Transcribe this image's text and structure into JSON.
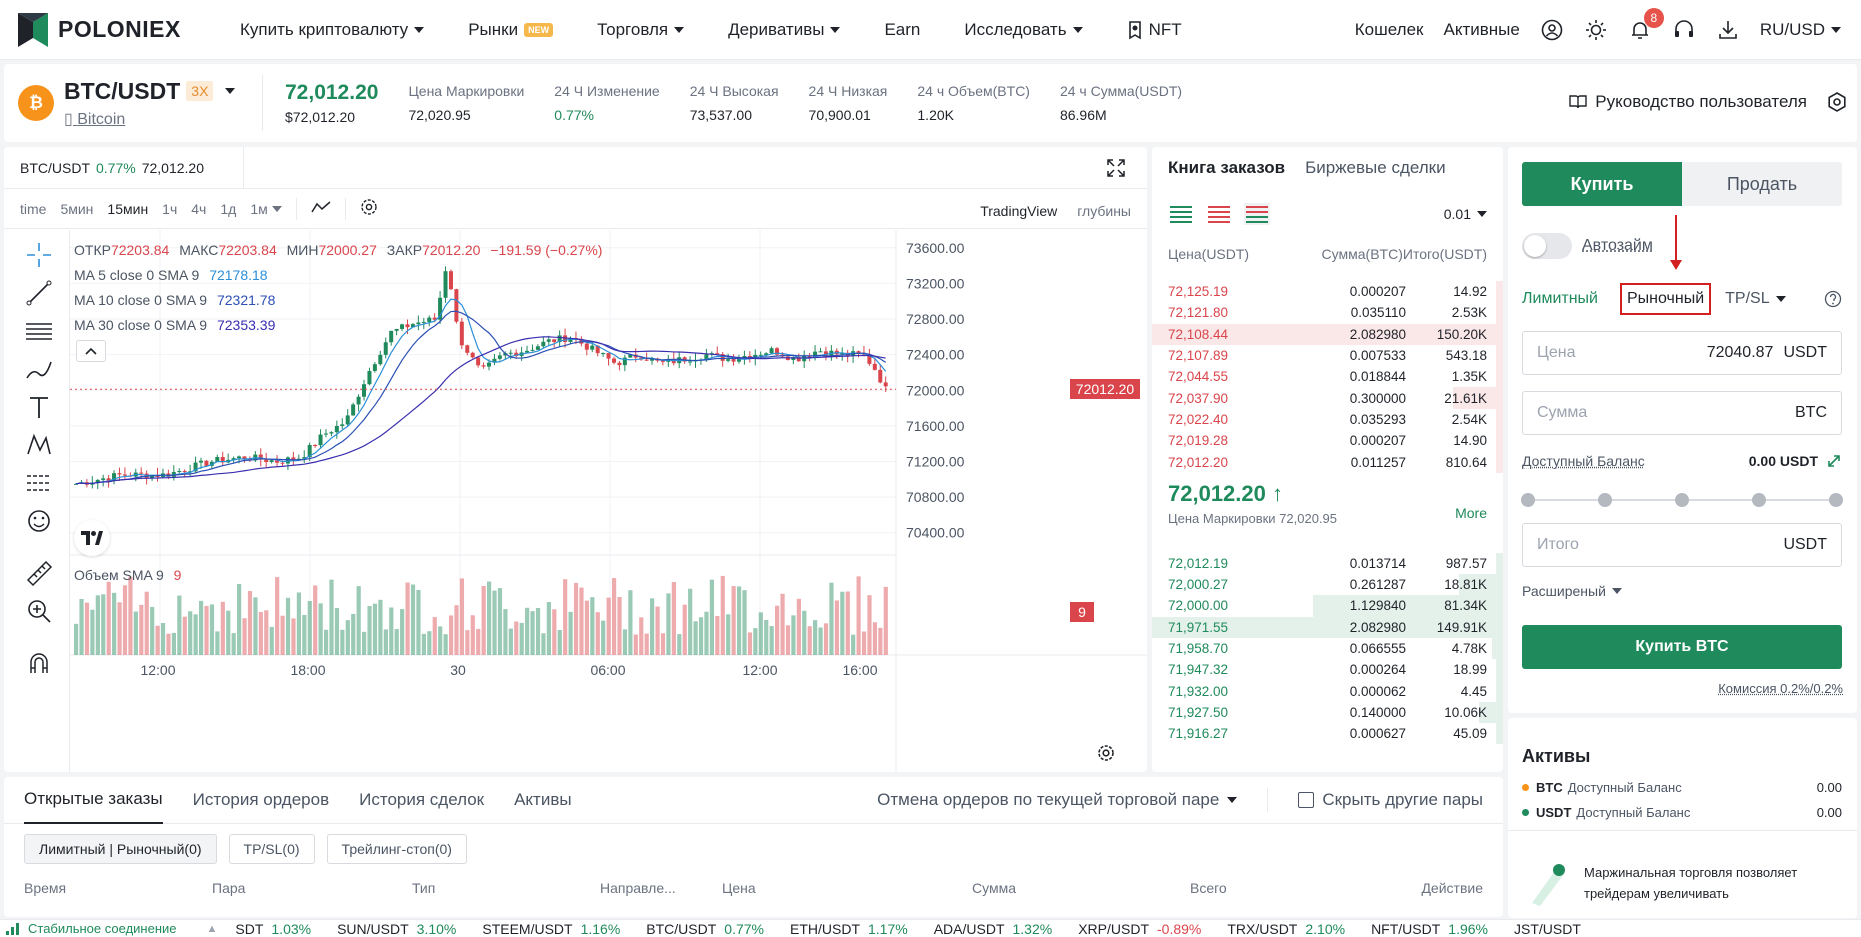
{
  "nav": {
    "brand": "POLONIEX",
    "items": [
      {
        "label": "Купить криптовалюту",
        "caret": true
      },
      {
        "label": "Рынки",
        "badge": "NEW"
      },
      {
        "label": "Торговля",
        "caret": true
      },
      {
        "label": "Деривативы",
        "caret": true
      },
      {
        "label": "Earn"
      },
      {
        "label": "Исследовать",
        "caret": true
      },
      {
        "label": "NFT"
      }
    ],
    "wallet": "Кошелек",
    "assets": "Активные",
    "notifications": "8",
    "locale": "RU/USD"
  },
  "ticker": {
    "pair": "BTC/USDT",
    "leverage": "3X",
    "coin_name": "Bitcoin",
    "last_price": "72,012.20",
    "last_price_usd": "$72,012.20",
    "mark_label": "Цена Маркировки",
    "mark_value": "72,020.95",
    "change_label": "24 Ч Изменение",
    "change_value": "0.77%",
    "high_label": "24 Ч Высокая",
    "high_value": "73,537.00",
    "low_label": "24 Ч Низкая",
    "low_value": "70,900.01",
    "volbtc_label": "24 ч Объем(BTC)",
    "volbtc_value": "1.20K",
    "volusdt_label": "24 ч Сумма(USDT)",
    "volusdt_value": "86.96M",
    "guide": "Руководство пользователя"
  },
  "chart": {
    "tab_pair": "BTC/USDT",
    "tab_change": "0.77%",
    "tab_price": "72,012.20",
    "intervals": [
      "time",
      "5мин",
      "15мин",
      "1ч",
      "4ч",
      "1д",
      "1м"
    ],
    "selected_interval": "15мин",
    "view_tv": "TradingView",
    "view_depth": "глубины",
    "ohlc": {
      "o_label": "ОТКР",
      "o": "72203.84",
      "h_label": "МАКС",
      "h": "72203.84",
      "l_label": "МИН",
      "l": "72000.27",
      "c_label": "ЗАКР",
      "c": "72012.20",
      "chg": "−191.59 (−0.27%)"
    },
    "ma": [
      {
        "label": "MA 5 close 0 SMA 9",
        "value": "72178.18",
        "color": "#2a8fd8"
      },
      {
        "label": "MA 10 close 0 SMA 9",
        "value": "72321.78",
        "color": "#2b4fb5"
      },
      {
        "label": "MA 30 close 0 SMA 9",
        "value": "72353.39",
        "color": "#3a2fb0"
      }
    ],
    "price_ticks": [
      "73600.00",
      "73200.00",
      "72800.00",
      "72400.00",
      "72000.00",
      "71600.00",
      "71200.00",
      "70800.00",
      "70400.00"
    ],
    "price_tag": "72012.20",
    "volume_label": "Объем SMA 9",
    "volume_value": "9",
    "volume_tag": "9",
    "time_ticks": [
      "12:00",
      "18:00",
      "30",
      "06:00",
      "12:00",
      "16:00"
    ]
  },
  "book": {
    "tab_book": "Книга заказов",
    "tab_trades": "Биржевые сделки",
    "step": "0.01",
    "headers": [
      "Цена(USDT)",
      "Сумма(BTC)",
      "Итого(USDT)"
    ],
    "asks": [
      [
        "72,125.19",
        "0.000207",
        "14.92"
      ],
      [
        "72,121.80",
        "0.035110",
        "2.53K"
      ],
      [
        "72,108.44",
        "2.082980",
        "150.20K"
      ],
      [
        "72,107.89",
        "0.007533",
        "543.18"
      ],
      [
        "72,044.55",
        "0.018844",
        "1.35K"
      ],
      [
        "72,037.90",
        "0.300000",
        "21.61K"
      ],
      [
        "72,022.40",
        "0.035293",
        "2.54K"
      ],
      [
        "72,019.28",
        "0.000207",
        "14.90"
      ],
      [
        "72,012.20",
        "0.011257",
        "810.64"
      ]
    ],
    "mid_price": "72,012.20 ↑",
    "mid_mark": "Цена Маркировки 72,020.95",
    "more": "More",
    "bids": [
      [
        "72,012.19",
        "0.013714",
        "987.57"
      ],
      [
        "72,000.27",
        "0.261287",
        "18.81K"
      ],
      [
        "72,000.00",
        "1.129840",
        "81.34K"
      ],
      [
        "71,971.55",
        "2.082980",
        "149.91K"
      ],
      [
        "71,958.70",
        "0.066555",
        "4.78K"
      ],
      [
        "71,947.32",
        "0.000264",
        "18.99"
      ],
      [
        "71,932.00",
        "0.000062",
        "4.45"
      ],
      [
        "71,927.50",
        "0.140000",
        "10.06K"
      ],
      [
        "71,916.27",
        "0.000627",
        "45.09"
      ]
    ]
  },
  "trade": {
    "buy": "Купить",
    "sell": "Продать",
    "autoloan": "Автозайм",
    "types": [
      "Лимитный",
      "Рыночный",
      "TP/SL"
    ],
    "price_label": "Цена",
    "price_value": "72040.87",
    "price_unit": "USDT",
    "amount_label": "Сумма",
    "amount_unit": "BTC",
    "balance_label": "Доступный Баланс",
    "balance_value": "0.00 USDT",
    "total_label": "Итого",
    "total_unit": "USDT",
    "advanced": "Расширеный",
    "buy_btn": "Купить BTC",
    "fee": "Комиссия 0.2%/0.2%"
  },
  "assets": {
    "title": "Активы",
    "rows": [
      {
        "coin": "BTC",
        "label": "Доступный Баланс",
        "value": "0.00",
        "color": "#f7931a"
      },
      {
        "coin": "USDT",
        "label": "Доступный Баланс",
        "value": "0.00",
        "color": "#1f8a5b"
      }
    ],
    "promo": "Маржинальная торговля позволяет трейдерам увеличивать"
  },
  "orders": {
    "tabs": [
      "Открытые заказы",
      "История ордеров",
      "История сделок",
      "Активы"
    ],
    "cancel": "Отмена ордеров по текущей торговой паре",
    "hide_pairs": "Скрыть другие пары",
    "chips": [
      "Лимитный | Рыночный(0)",
      "TP/SL(0)",
      "Трейлинг-стоп(0)"
    ],
    "columns": [
      "Время",
      "Пара",
      "Тип",
      "Направле...",
      "Цена",
      "Сумма",
      "Всего",
      "Действие"
    ]
  },
  "status": {
    "connection": "Стабильное соединение",
    "tickers": [
      {
        "pair": "SDT",
        "chg": "1.03%",
        "up": true
      },
      {
        "pair": "SUN/USDT",
        "chg": "3.10%",
        "up": true
      },
      {
        "pair": "STEEM/USDT",
        "chg": "1.16%",
        "up": true
      },
      {
        "pair": "BTC/USDT",
        "chg": "0.77%",
        "up": true
      },
      {
        "pair": "ETH/USDT",
        "chg": "1.17%",
        "up": true
      },
      {
        "pair": "ADA/USDT",
        "chg": "1.32%",
        "up": true
      },
      {
        "pair": "XRP/USDT",
        "chg": "-0.89%",
        "up": false
      },
      {
        "pair": "TRX/USDT",
        "chg": "2.10%",
        "up": true
      },
      {
        "pair": "NFT/USDT",
        "chg": "1.96%",
        "up": true
      },
      {
        "pair": "JST/USDT",
        "chg": "",
        "up": true
      }
    ]
  },
  "colors": {
    "green": "#1f8a5b",
    "red": "#d9454b",
    "accent_orange": "#f7931a"
  }
}
